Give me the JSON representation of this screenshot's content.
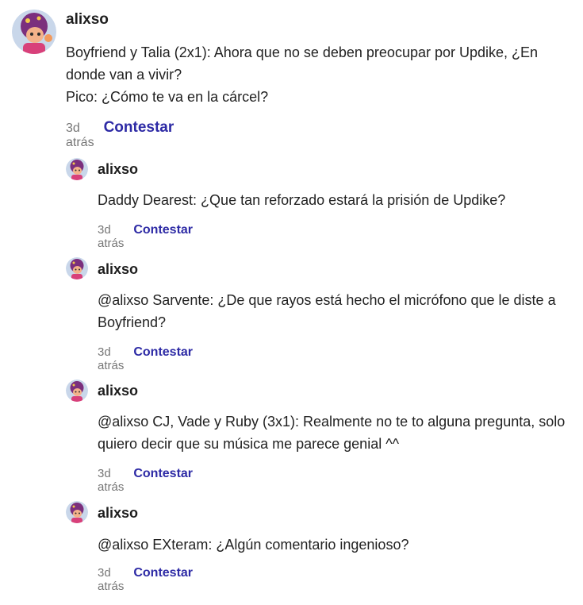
{
  "comments": [
    {
      "username": "alixso",
      "text": "Boyfriend y Talia (2x1): Ahora que no se deben preocupar por Updike, ¿En donde van a vivir?\nPico: ¿Cómo te va en la cárcel?",
      "time": "3d atrás",
      "reply_label": "Contestar"
    },
    {
      "username": "alixso",
      "text": "Daddy Dearest: ¿Que tan reforzado estará la prisión de Updike?",
      "time": "3d atrás",
      "reply_label": "Contestar"
    },
    {
      "username": "alixso",
      "text": "@alixso Sarvente: ¿De que rayos está hecho el micrófono que le diste a Boyfriend?",
      "time": "3d atrás",
      "reply_label": "Contestar"
    },
    {
      "username": "alixso",
      "text": "@alixso CJ, Vade y Ruby (3x1): Realmente no te to alguna pregunta, solo quiero decir que su música me parece genial ^^",
      "time": "3d atrás",
      "reply_label": "Contestar"
    },
    {
      "username": "alixso",
      "text": "@alixso EXteram: ¿Algún comentario ingenioso?",
      "time": "3d atrás",
      "reply_label": "Contestar"
    }
  ]
}
